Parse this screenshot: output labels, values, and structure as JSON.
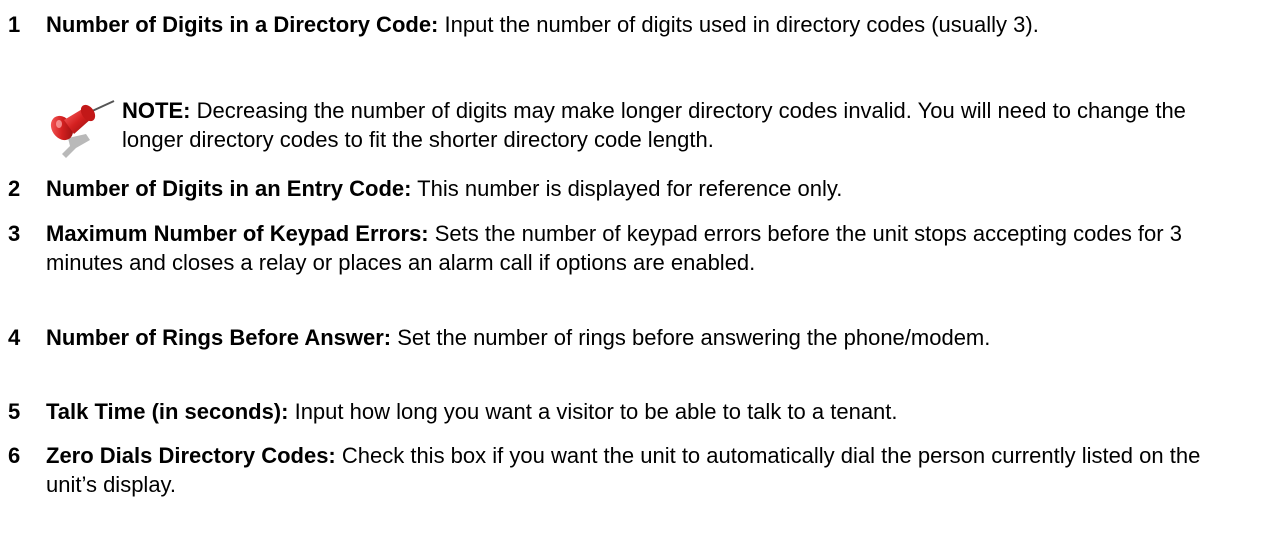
{
  "items": [
    {
      "number": "1",
      "term": "Number of Digits in a Directory Code:",
      "text": " Input the number of digits used in directory codes (usually 3)."
    },
    {
      "number": "2",
      "term": "Number of Digits in an Entry Code:",
      "text": " This number is displayed for reference only."
    },
    {
      "number": "3",
      "term": "Maximum Number of Keypad Errors:",
      "text": "  Sets the number of keypad errors before the unit stops accepting codes for 3 minutes and closes a relay or places an alarm call if options are enabled."
    },
    {
      "number": "4",
      "term": "Number of Rings Before Answer:",
      "text": " Set the number of rings before answering the phone/modem."
    },
    {
      "number": "5",
      "term": "Talk Time (in seconds):",
      "text": " Input how long you want a visitor to be able to talk to a tenant."
    },
    {
      "number": "6",
      "term": "Zero Dials Directory Codes:",
      "text": " Check this box if you want the unit to automatically dial the person currently listed on the unit’s display."
    }
  ],
  "note": {
    "label": "NOTE:",
    "text": " Decreasing the number of digits may make longer directory codes invalid.  You will need to change the longer directory codes to fit the shorter directory code length.",
    "icon": "pushpin-icon",
    "icon_color": "#d42020"
  }
}
